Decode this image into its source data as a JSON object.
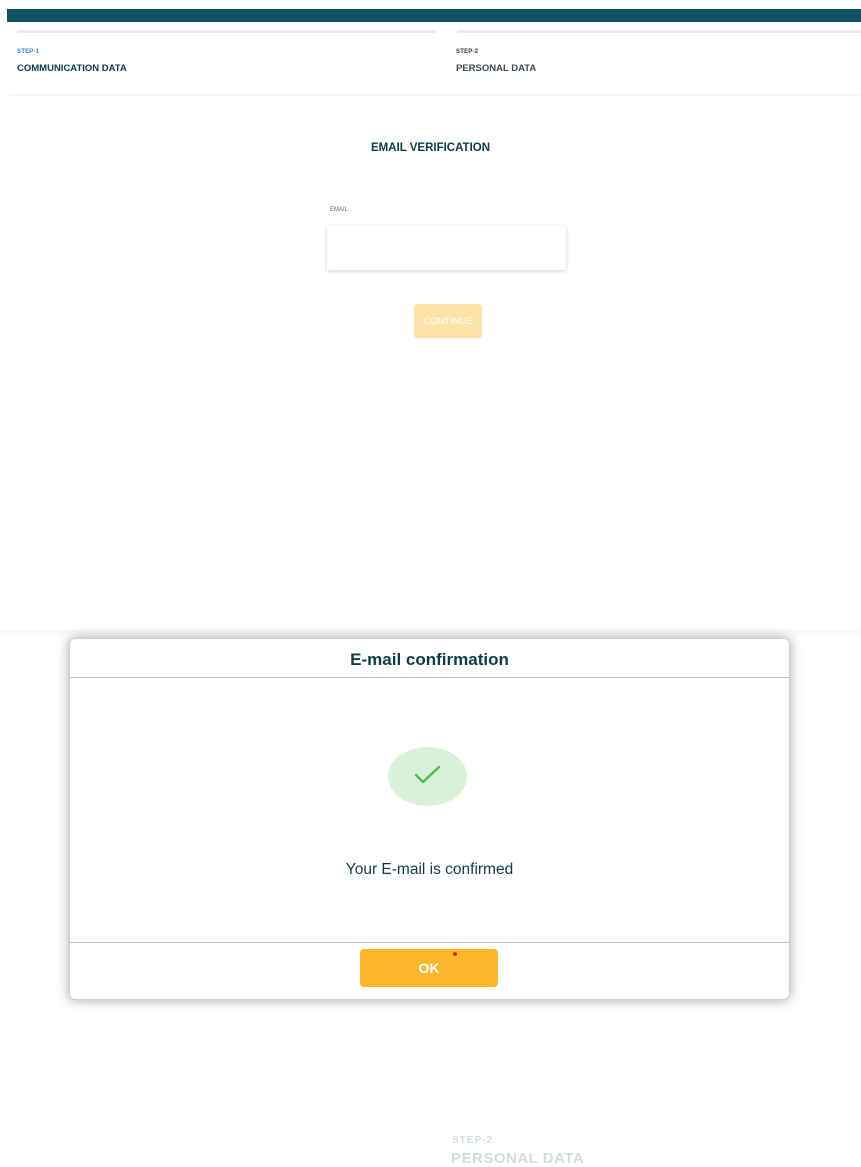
{
  "stepper": {
    "steps": [
      {
        "number": "STEP-1",
        "title": "COMMUNICATION DATA"
      },
      {
        "number": "STEP-2",
        "title": "PERSONAL DATA"
      }
    ]
  },
  "form": {
    "title": "EMAIL VERIFICATION",
    "email_label": "EMAIL",
    "email_value": "",
    "continue_label": "CONTINUE"
  },
  "background_step": {
    "number": "STEP-2",
    "title": "PERSONAL DATA"
  },
  "modal": {
    "title": "E-mail confirmation",
    "icon": "check-icon",
    "message": "Your E-mail is confirmed",
    "ok_label": "OK"
  },
  "colors": {
    "brand_dark": "#0f5260",
    "accent": "#fcb72b",
    "success_bg": "#d8f1d8",
    "success_check": "#4cbb4f"
  }
}
